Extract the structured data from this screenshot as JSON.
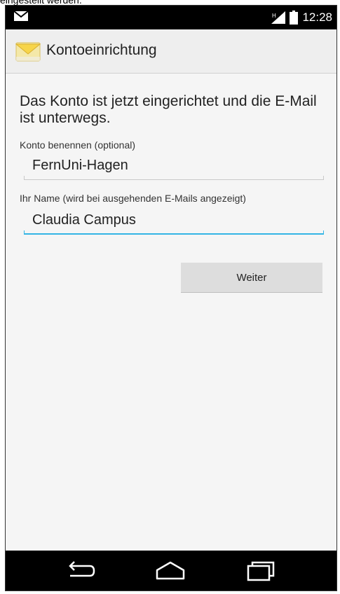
{
  "document": {
    "caption": "eingestellt werden."
  },
  "statusbar": {
    "time": "12:28",
    "left_icon": "mail-icon",
    "right_icons": [
      "signal-icon",
      "battery-icon"
    ]
  },
  "actionbar": {
    "title": "Kontoeinrichtung",
    "icon": "email-app-icon"
  },
  "form": {
    "intro": "Das Konto ist jetzt eingerichtet und die E-Mail ist unterwegs.",
    "account_name_label": "Konto benennen (optional)",
    "account_name_value": "FernUni-Hagen",
    "your_name_label": "Ihr Name (wird bei ausgehenden E-Mails angezeigt)",
    "your_name_value": "Claudia Campus",
    "next_button": "Weiter"
  },
  "navbar": {
    "icons": [
      "back-icon",
      "home-icon",
      "recent-apps-icon"
    ]
  },
  "colors": {
    "focus_accent": "#33b5e5",
    "bar_background": "#000000",
    "button_background": "#dddddd"
  }
}
